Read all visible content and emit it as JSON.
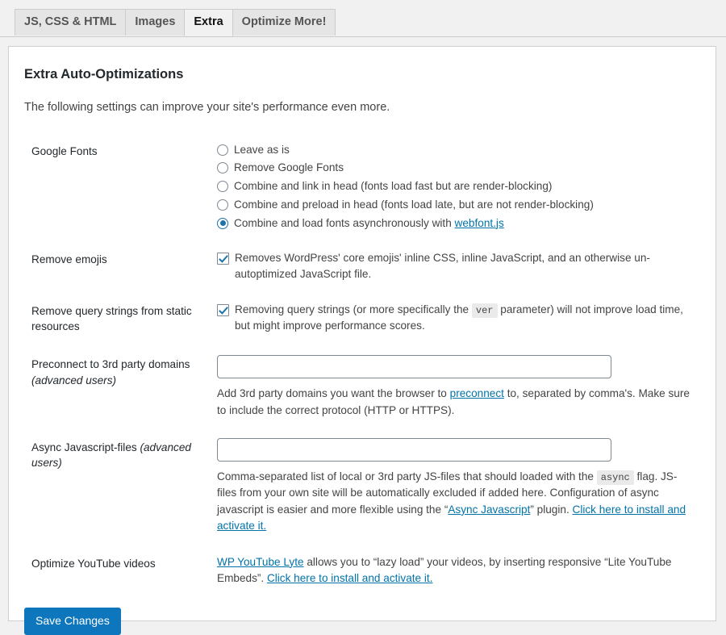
{
  "tabs": [
    {
      "label": "JS, CSS & HTML",
      "active": false
    },
    {
      "label": "Images",
      "active": false
    },
    {
      "label": "Extra",
      "active": true
    },
    {
      "label": "Optimize More!",
      "active": false
    }
  ],
  "page": {
    "title": "Extra Auto-Optimizations",
    "intro": "The following settings can improve your site's performance even more."
  },
  "settings": {
    "google_fonts": {
      "label": "Google Fonts",
      "options": [
        {
          "label": "Leave as is",
          "selected": false
        },
        {
          "label": "Remove Google Fonts",
          "selected": false
        },
        {
          "label": "Combine and link in head (fonts load fast but are render-blocking)",
          "selected": false
        },
        {
          "label": "Combine and preload in head (fonts load late, but are not render-blocking)",
          "selected": false
        },
        {
          "label": "Combine and load fonts asynchronously with ",
          "link": "webfont.js",
          "selected": true
        }
      ]
    },
    "remove_emojis": {
      "label": "Remove emojis",
      "checked": true,
      "description": "Removes WordPress' core emojis' inline CSS, inline JavaScript, and an otherwise un-autoptimized JavaScript file."
    },
    "remove_query_strings": {
      "label": "Remove query strings from static resources",
      "checked": true,
      "desc_part1": "Removing query strings (or more specifically the ",
      "code": "ver",
      "desc_part2": " parameter) will not improve load time, but might improve performance scores."
    },
    "preconnect": {
      "label_main": "Preconnect to 3rd party domains ",
      "label_em": "(advanced users)",
      "value": "",
      "placeholder": "",
      "desc_part1": "Add 3rd party domains you want the browser to ",
      "link": "preconnect",
      "desc_part2": " to, separated by comma's. Make sure to include the correct protocol (HTTP or HTTPS)."
    },
    "async_js": {
      "label_main": "Async Javascript-files ",
      "label_em": "(advanced users)",
      "value": "",
      "placeholder": "",
      "desc_part1": "Comma-separated list of local or 3rd party JS-files that should loaded with the ",
      "code": "async",
      "desc_part2": " flag. JS-files from your own site will be automatically excluded if added here. Configuration of async javascript is easier and more flexible using the “",
      "link1": "Async Javascript",
      "desc_part3": "” plugin. ",
      "link2": "Click here to install and activate it."
    },
    "youtube": {
      "label": "Optimize YouTube videos",
      "link1": "WP YouTube Lyte",
      "desc_part1": " allows you to “lazy load” your videos, by inserting responsive “Lite YouTube Embeds”. ",
      "link2": "Click here to install and activate it."
    }
  },
  "submit": {
    "save_label": "Save Changes"
  },
  "colors": {
    "accent": "#0e76bc",
    "link": "#0073aa",
    "page_bg": "#f1f1f1",
    "card_bg": "#ffffff",
    "border": "#ccd0d4"
  }
}
